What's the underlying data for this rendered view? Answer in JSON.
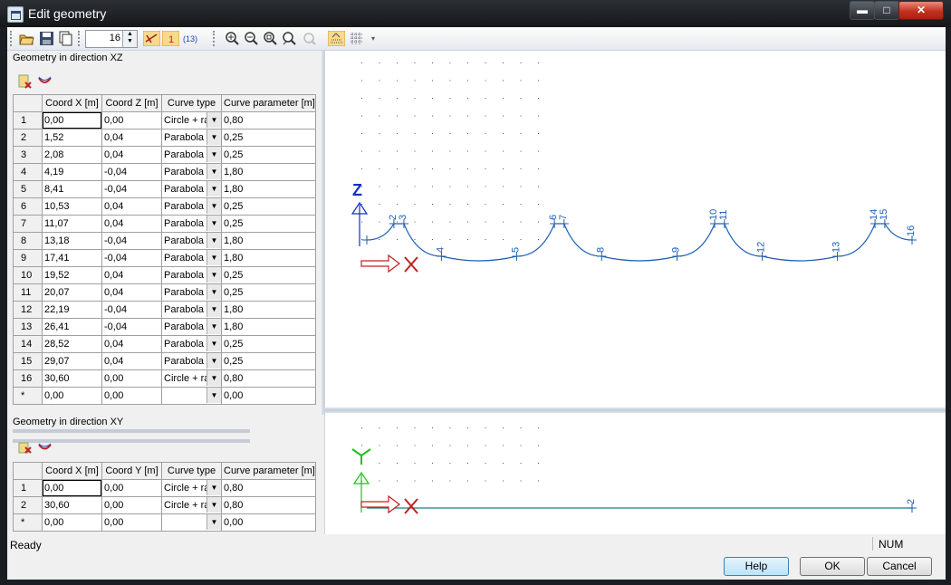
{
  "window": {
    "title": "Edit geometry",
    "min_label": "▬",
    "max_label": "□",
    "close_label": "✕"
  },
  "toolbar": {
    "count_value": "16",
    "icons": [
      "open-icon",
      "save-icon",
      "copy-icon",
      "count-spinner",
      "toggle-x-icon",
      "toggle-1-icon",
      "toggle-13-icon",
      "zoom-in-icon",
      "zoom-out-icon",
      "zoom-fit-icon",
      "zoom-all-icon",
      "undo-zoom-icon",
      "fill-icon",
      "grid-icon"
    ]
  },
  "xz": {
    "title": "Geometry in direction XZ",
    "columns": [
      "",
      "Coord X [m]",
      "Coord Z [m]",
      "Curve type",
      "Curve parameter [m]"
    ],
    "rows": [
      [
        "1",
        "0,00",
        "0,00",
        "Circle + ra",
        "0,80"
      ],
      [
        "2",
        "1,52",
        "0,04",
        "Parabola",
        "0,25"
      ],
      [
        "3",
        "2,08",
        "0,04",
        "Parabola",
        "0,25"
      ],
      [
        "4",
        "4,19",
        "-0,04",
        "Parabola",
        "1,80"
      ],
      [
        "5",
        "8,41",
        "-0,04",
        "Parabola",
        "1,80"
      ],
      [
        "6",
        "10,53",
        "0,04",
        "Parabola",
        "0,25"
      ],
      [
        "7",
        "11,07",
        "0,04",
        "Parabola",
        "0,25"
      ],
      [
        "8",
        "13,18",
        "-0,04",
        "Parabola",
        "1,80"
      ],
      [
        "9",
        "17,41",
        "-0,04",
        "Parabola",
        "1,80"
      ],
      [
        "10",
        "19,52",
        "0,04",
        "Parabola",
        "0,25"
      ],
      [
        "11",
        "20,07",
        "0,04",
        "Parabola",
        "0,25"
      ],
      [
        "12",
        "22,19",
        "-0,04",
        "Parabola",
        "1,80"
      ],
      [
        "13",
        "26,41",
        "-0,04",
        "Parabola",
        "1,80"
      ],
      [
        "14",
        "28,52",
        "0,04",
        "Parabola",
        "0,25"
      ],
      [
        "15",
        "29,07",
        "0,04",
        "Parabola",
        "0,25"
      ],
      [
        "16",
        "30,60",
        "0,00",
        "Circle + ra",
        "0,80"
      ],
      [
        "*",
        "0,00",
        "0,00",
        "",
        "0,00"
      ]
    ],
    "axis_z": "Z",
    "axis_x": "X",
    "node_labels": [
      "2",
      "3",
      "4",
      "5",
      "6",
      "7",
      "8",
      "9",
      "10",
      "11",
      "12",
      "13",
      "14",
      "15",
      "16"
    ]
  },
  "xy": {
    "title": "Geometry in direction XY",
    "columns": [
      "",
      "Coord X [m]",
      "Coord Y [m]",
      "Curve type",
      "Curve parameter [m]"
    ],
    "rows": [
      [
        "1",
        "0,00",
        "0,00",
        "Circle + ra",
        "0,80"
      ],
      [
        "2",
        "30,60",
        "0,00",
        "Circle + ra",
        "0,80"
      ],
      [
        "*",
        "0,00",
        "0,00",
        "",
        "0,00"
      ]
    ],
    "axis_y": "Y",
    "axis_x": "X",
    "node_labels": [
      "2"
    ]
  },
  "status": {
    "text": "Ready",
    "num": "NUM"
  },
  "buttons": {
    "help": "Help",
    "ok": "OK",
    "cancel": "Cancel"
  },
  "colors": {
    "curve": "#1f5fb0",
    "axis_z": "#1030c0",
    "axis_y": "#20c020",
    "axis_x": "#c02020"
  }
}
